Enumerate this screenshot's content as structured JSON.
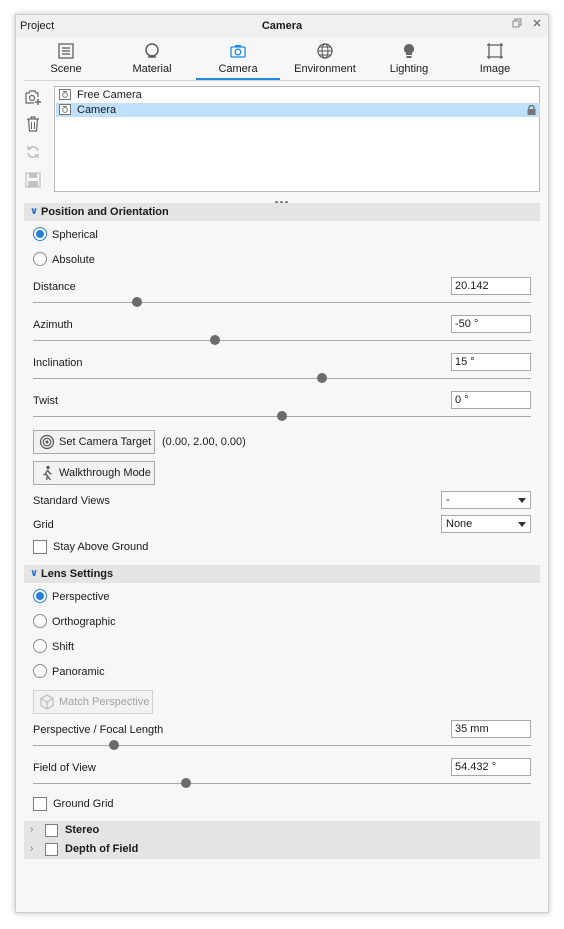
{
  "window": {
    "left_title": "Project",
    "title": "Camera",
    "restore_icon": "restore-icon",
    "close_icon": "close-icon"
  },
  "tabs": [
    {
      "label": "Scene",
      "icon": "scene-list-icon"
    },
    {
      "label": "Material",
      "icon": "material-sphere-icon"
    },
    {
      "label": "Camera",
      "icon": "camera-icon",
      "active": true
    },
    {
      "label": "Environment",
      "icon": "globe-icon"
    },
    {
      "label": "Lighting",
      "icon": "lightbulb-icon"
    },
    {
      "label": "Image",
      "icon": "image-frame-icon"
    }
  ],
  "toolbar": [
    "add-camera-icon",
    "trash-icon",
    "refresh-icon",
    "save-icon"
  ],
  "cameras": [
    {
      "name": "Free Camera",
      "selected": false
    },
    {
      "name": "Camera",
      "selected": true,
      "locked": true
    }
  ],
  "position": {
    "title": "Position and Orientation",
    "mode_options": [
      "Spherical",
      "Absolute"
    ],
    "mode_selected": "Spherical",
    "distance": {
      "label": "Distance",
      "value": "20.142",
      "level": 0.21
    },
    "azimuth": {
      "label": "Azimuth",
      "value": "-50 °",
      "level": 0.36
    },
    "inclination": {
      "label": "Inclination",
      "value": "15 °",
      "level": 0.58
    },
    "twist": {
      "label": "Twist",
      "value": "0 °",
      "level": 0.5
    },
    "set_target_label": "Set Camera Target",
    "target_coords": "(0.00, 2.00, 0.00)",
    "walkthrough_label": "Walkthrough Mode",
    "standard_views": {
      "label": "Standard Views",
      "value": "-"
    },
    "grid": {
      "label": "Grid",
      "value": "None"
    },
    "stay_above_ground": {
      "label": "Stay Above Ground",
      "checked": false
    }
  },
  "lens": {
    "title": "Lens Settings",
    "options": [
      "Perspective",
      "Orthographic",
      "Shift",
      "Panoramic"
    ],
    "selected": "Perspective",
    "match_perspective_label": "Match Perspective",
    "focal_length": {
      "label": "Perspective / Focal Length",
      "value": "35 mm",
      "level": 0.16
    },
    "fov": {
      "label": "Field of View",
      "value": "54.432 °",
      "level": 0.31
    },
    "ground_grid": {
      "label": "Ground Grid",
      "checked": false
    }
  },
  "collapsed_sections": [
    {
      "label": "Stereo",
      "checked": false
    },
    {
      "label": "Depth of Field",
      "checked": false
    }
  ],
  "colors": {
    "accent": "#1e88e5",
    "selection": "#bfe0fa",
    "section_bg": "#e4e4e4"
  }
}
